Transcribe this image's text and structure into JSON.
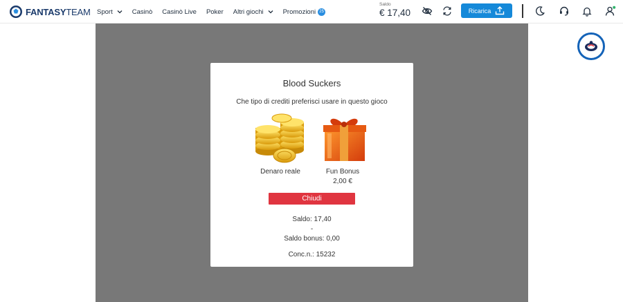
{
  "header": {
    "logo_brand": "FANTASY",
    "logo_suffix": "TEAM",
    "nav": [
      {
        "label": "Sport",
        "dropdown": true
      },
      {
        "label": "Casinò",
        "dropdown": false
      },
      {
        "label": "Casinò Live",
        "dropdown": false
      },
      {
        "label": "Poker",
        "dropdown": false
      },
      {
        "label": "Altri giochi",
        "dropdown": true
      },
      {
        "label": "Promozioni",
        "dropdown": false,
        "badge": "25"
      }
    ],
    "balance_label": "Saldo",
    "balance_value": "€ 17,40",
    "recharge_label": "Ricarica",
    "icons": [
      "hide-balance-icon",
      "refresh-icon",
      "upload-icon",
      "dark-mode-icon",
      "support-icon",
      "bell-icon",
      "user-icon"
    ]
  },
  "modal": {
    "title": "Blood Suckers",
    "question": "Che tipo di crediti preferisci usare in questo gioco",
    "options": [
      {
        "label": "Denaro reale",
        "icon": "gold-coins-icon"
      },
      {
        "label": "Fun Bonus",
        "amount": "2,00 €",
        "icon": "gift-box-icon"
      }
    ],
    "close_label": "Chiudi",
    "saldo": "Saldo: 17,40",
    "separator": "-",
    "saldo_bonus": "Saldo bonus: 0,00",
    "conc": "Conc.n.: 15232"
  },
  "colors": {
    "brand_blue": "#1589d9",
    "close_red": "#e03540",
    "overlay_grey": "#787878",
    "logo_navy": "#1a3a6b"
  },
  "chat_icon": "live-chat-icon"
}
